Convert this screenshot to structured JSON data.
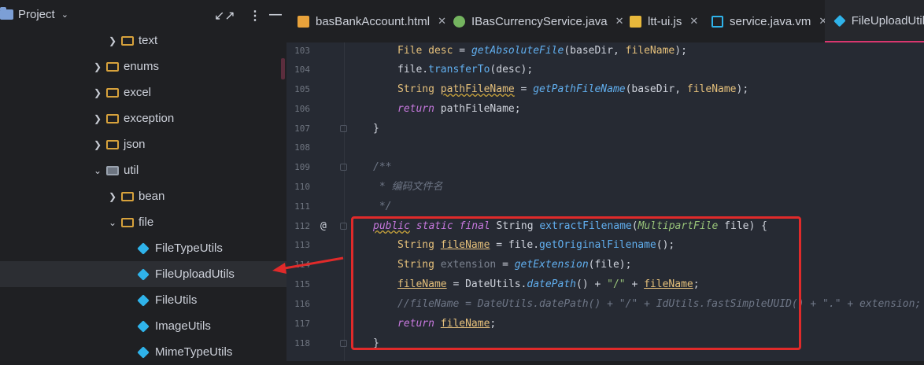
{
  "sidebar": {
    "title": "Project",
    "items": [
      {
        "label": "text",
        "kind": "folder",
        "expanded": false
      },
      {
        "label": "enums",
        "kind": "folder",
        "expanded": false
      },
      {
        "label": "excel",
        "kind": "folder",
        "expanded": false
      },
      {
        "label": "exception",
        "kind": "folder",
        "expanded": false
      },
      {
        "label": "json",
        "kind": "folder",
        "expanded": false
      },
      {
        "label": "util",
        "kind": "folder",
        "expanded": true
      },
      {
        "label": "bean",
        "kind": "folder",
        "expanded": false
      },
      {
        "label": "file",
        "kind": "folder",
        "expanded": true
      },
      {
        "label": "FileTypeUtils",
        "kind": "class"
      },
      {
        "label": "FileUploadUtils",
        "kind": "class",
        "selected": true
      },
      {
        "label": "FileUtils",
        "kind": "class"
      },
      {
        "label": "ImageUtils",
        "kind": "class"
      },
      {
        "label": "MimeTypeUtils",
        "kind": "class"
      }
    ]
  },
  "tabs": [
    {
      "label": "basBankAccount.html",
      "icon": "html5-icon",
      "color": "#e8a23b"
    },
    {
      "label": "IBasCurrencyService.java",
      "icon": "interface-icon",
      "color": "#74b45f"
    },
    {
      "label": "ltt-ui.js",
      "icon": "js-icon",
      "color": "#e8b83b"
    },
    {
      "label": "service.java.vm",
      "icon": "velocity-icon",
      "color": "#2fb3ea"
    },
    {
      "label": "FileUploadUtils",
      "icon": "class-icon",
      "color": "#2fb3ea",
      "active": true
    }
  ],
  "code": {
    "line_numbers": [
      "103",
      "104",
      "105",
      "106",
      "107",
      "108",
      "109",
      "110",
      "111",
      "112",
      "113",
      "114",
      "115",
      "116",
      "117",
      "118"
    ],
    "lines": {
      "l103": {
        "a": "File ",
        "b": "desc",
        "c": " = ",
        "d": "getAbsoluteFile",
        "e": "(baseDir, ",
        "f": "fileName",
        "g": ");"
      },
      "l104": {
        "a": "file.",
        "b": "transferTo",
        "c": "(desc);"
      },
      "l105": {
        "a": "String ",
        "b": "pathFileName",
        "c": " = ",
        "d": "getPathFileName",
        "e": "(baseDir, ",
        "f": "fileName",
        "g": ");"
      },
      "l106": {
        "a": "return ",
        "b": "pathFileName;"
      },
      "l107": {
        "a": "}"
      },
      "l109": {
        "a": "/**"
      },
      "l110": {
        "a": " * 编码文件名"
      },
      "l111": {
        "a": " */"
      },
      "l112": {
        "a": "public",
        "b": " ",
        "c": "static",
        "d": " ",
        "e": "final",
        "f": " String ",
        "g": "extractFilename",
        "h": "(",
        "i": "MultipartFile",
        "j": " file) {"
      },
      "l113": {
        "a": "String ",
        "b": "fileName",
        "c": " = file.",
        "d": "getOriginalFilename",
        "e": "();"
      },
      "l114": {
        "a": "String ",
        "b": "extension",
        "c": " = ",
        "d": "getExtension",
        "e": "(file);"
      },
      "l115": {
        "a": "fileName",
        "b": " = DateUtils.",
        "c": "datePath",
        "d": "() + ",
        "e": "\"/\"",
        "f": " + ",
        "g": "fileName",
        ";": ";"
      },
      "l116": {
        "a": "//fileName = DateUtils.datePath() + \"/\" + IdUtils.fastSimpleUUID() + \".\" + extension;"
      },
      "l117": {
        "a": "return ",
        "b": "fileName",
        ";": ";"
      },
      "l118": {
        "a": "}"
      }
    },
    "override_marker": "@"
  },
  "colors": {
    "highlight_box": "#e02a2a",
    "active_tab_underline": "#d8366f"
  }
}
